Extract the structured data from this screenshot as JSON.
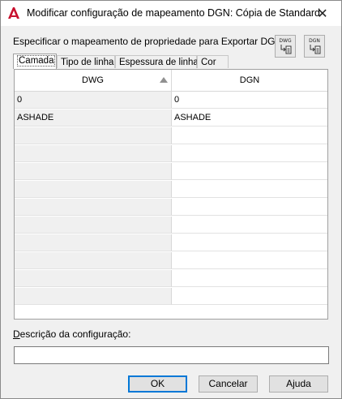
{
  "window": {
    "title": "Modificar configuração de mapeamento DGN: Cópia de Standard",
    "close_glyph": "✕"
  },
  "instruction": "Especificar o mapeamento de propriedade para Exportar DGN",
  "toolbar": {
    "dwg_button": {
      "label": "DWG",
      "icon": "map-arrow-icon"
    },
    "dgn_button": {
      "label": "DGN",
      "icon": "map-arrow-icon"
    }
  },
  "tabs": [
    {
      "label": "Camada",
      "active": true
    },
    {
      "label": "Tipo de linha",
      "active": false
    },
    {
      "label": "Espessura de linha",
      "active": false
    },
    {
      "label": "Cor",
      "active": false
    }
  ],
  "grid": {
    "columns": [
      "DWG",
      "DGN"
    ],
    "sort_indicator": "ascending",
    "rows": [
      {
        "dwg": "0",
        "dgn": "0"
      },
      {
        "dwg": "ASHADE",
        "dgn": "ASHADE"
      },
      {
        "dwg": "",
        "dgn": ""
      },
      {
        "dwg": "",
        "dgn": ""
      },
      {
        "dwg": "",
        "dgn": ""
      },
      {
        "dwg": "",
        "dgn": ""
      },
      {
        "dwg": "",
        "dgn": ""
      },
      {
        "dwg": "",
        "dgn": ""
      },
      {
        "dwg": "",
        "dgn": ""
      },
      {
        "dwg": "",
        "dgn": ""
      },
      {
        "dwg": "",
        "dgn": ""
      },
      {
        "dwg": "",
        "dgn": ""
      }
    ]
  },
  "description": {
    "label_underlined": "D",
    "label_rest": "escrição da configuração:",
    "value": ""
  },
  "buttons": {
    "ok": "OK",
    "cancel": "Cancelar",
    "help": "Ajuda"
  },
  "colors": {
    "accent": "#0078d7",
    "app_icon": "#c8102e"
  }
}
